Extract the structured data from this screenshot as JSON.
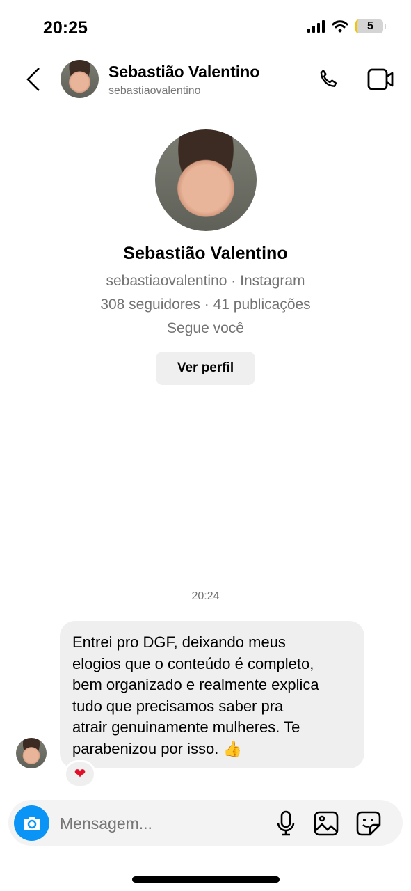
{
  "status_bar": {
    "time": "20:25",
    "battery": "5"
  },
  "header": {
    "name": "Sebastião Valentino",
    "username": "sebastiaovalentino"
  },
  "profile": {
    "name": "Sebastião Valentino",
    "username_source": "sebastiaovalentino · Instagram",
    "stats": "308 seguidores · 41 publicações",
    "follow_status": "Segue você",
    "view_profile_label": "Ver perfil"
  },
  "chat": {
    "timestamp": "20:24",
    "messages": [
      {
        "text": "Entrei pro DGF, deixando meus\nelogios que o conteúdo é completo,\nbem organizado e realmente explica\ntudo que precisamos saber pra\natrair genuinamente mulheres. Te\nparabenizou por isso. 👍",
        "reaction": "❤"
      }
    ]
  },
  "composer": {
    "placeholder": "Mensagem..."
  },
  "colors": {
    "accent": "#0a95f6",
    "bubble": "#efefef"
  }
}
